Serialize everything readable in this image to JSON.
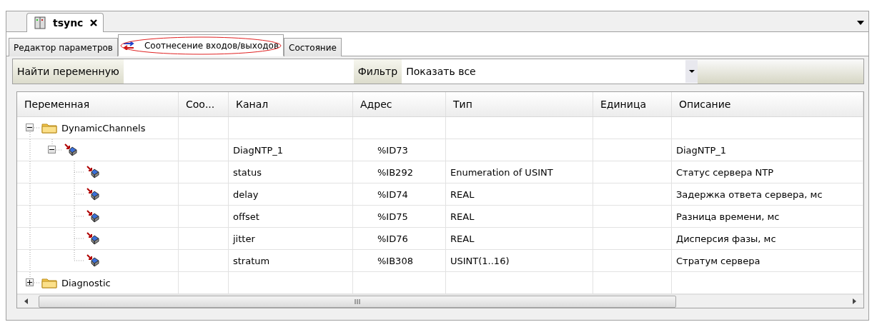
{
  "document_tab": {
    "title": "tsync",
    "selected": true
  },
  "tabs": [
    {
      "label": "Редактор параметров",
      "selected": false,
      "highlighted": false
    },
    {
      "label": "Соотнесение входов/выходов",
      "selected": true,
      "highlighted": true
    },
    {
      "label": "Состояние",
      "selected": false,
      "highlighted": false
    }
  ],
  "toolbar": {
    "search_label": "Найти переменную",
    "filter_label": "Фильтр",
    "filter_value": "Показать все"
  },
  "table": {
    "columns": [
      "Переменная",
      "Соо...",
      "Канал",
      "Адрес",
      "Тип",
      "Единица",
      "Описание"
    ],
    "rows": [
      {
        "kind": "folder",
        "name": "DynamicChannels",
        "expanded": true,
        "children": [
          {
            "kind": "channel",
            "channel": "DiagNTP_1",
            "address": "%ID73",
            "description": "DiagNTP_1",
            "expanded": true,
            "children": [
              {
                "kind": "channel",
                "channel": "status",
                "address": "%IB292",
                "type": "Enumeration of USINT",
                "description": "Статус сервера NTP"
              },
              {
                "kind": "channel",
                "channel": "delay",
                "address": "%ID74",
                "type": "REAL",
                "description": "Задержка ответа сервера, мс"
              },
              {
                "kind": "channel",
                "channel": "offset",
                "address": "%ID75",
                "type": "REAL",
                "description": "Разница времени, мс"
              },
              {
                "kind": "channel",
                "channel": "jitter",
                "address": "%ID76",
                "type": "REAL",
                "description": "Дисперсия фазы, мс"
              },
              {
                "kind": "channel",
                "channel": "stratum",
                "address": "%IB308",
                "type": "USINT(1..16)",
                "description": "Стратум сервера"
              }
            ]
          }
        ]
      },
      {
        "kind": "folder",
        "name": "Diagnostic",
        "expanded": false
      }
    ]
  }
}
